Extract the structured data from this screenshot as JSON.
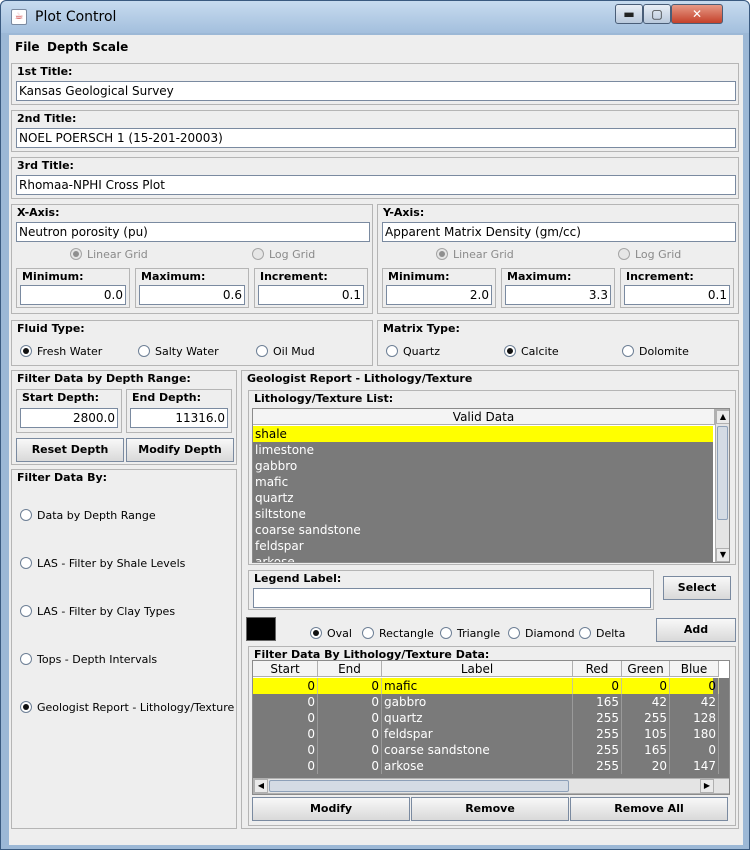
{
  "window": {
    "title": "Plot Control",
    "controls": {
      "minimize": "▬",
      "maximize": "▢",
      "close": "✕"
    }
  },
  "menu": [
    "File",
    "Depth Scale"
  ],
  "titles": [
    {
      "label": "1st Title:",
      "value": "Kansas Geological Survey"
    },
    {
      "label": "2nd Title:",
      "value": "NOEL POERSCH 1 (15-201-20003)"
    },
    {
      "label": "3rd Title:",
      "value": "Rhomaa-NPHI Cross Plot"
    }
  ],
  "xaxis": {
    "label": "X-Axis:",
    "name": "Neutron porosity (pu)",
    "linear": "Linear Grid",
    "log": "Log Grid",
    "min_label": "Minimum:",
    "min": "0.0",
    "max_label": "Maximum:",
    "max": "0.6",
    "inc_label": "Increment:",
    "inc": "0.1"
  },
  "yaxis": {
    "label": "Y-Axis:",
    "name": "Apparent Matrix Density (gm/cc)",
    "linear": "Linear Grid",
    "log": "Log Grid",
    "min_label": "Minimum:",
    "min": "2.0",
    "max_label": "Maximum:",
    "max": "3.3",
    "inc_label": "Increment:",
    "inc": "0.1"
  },
  "fluid": {
    "label": "Fluid Type:",
    "options": [
      "Fresh Water",
      "Salty Water",
      "Oil Mud"
    ],
    "selected": "Fresh Water"
  },
  "matrix": {
    "label": "Matrix Type:",
    "options": [
      "Quartz",
      "Calcite",
      "Dolomite"
    ],
    "selected": "Calcite"
  },
  "depth_range": {
    "label": "Filter Data by Depth Range:",
    "start_label": "Start Depth:",
    "start": "2800.0",
    "end_label": "End Depth:",
    "end": "11316.0",
    "reset": "Reset Depth",
    "modify": "Modify Depth"
  },
  "filter_by": {
    "label": "Filter Data By:",
    "options": [
      "Data by Depth Range",
      "LAS - Filter by Shale Levels",
      "LAS - Filter by Clay Types",
      "Tops - Depth Intervals",
      "Geologist Report - Lithology/Texture"
    ],
    "selected": "Geologist Report - Lithology/Texture"
  },
  "geo": {
    "label": "Geologist Report - Lithology/Texture",
    "list_label": "Lithology/Texture List:",
    "list_header": "Valid Data",
    "list_items": [
      "shale",
      "limestone",
      "gabbro",
      "mafic",
      "quartz",
      "siltstone",
      "coarse sandstone",
      "feldspar",
      "arkose"
    ],
    "list_selected": "shale",
    "legend_label": "Legend Label:",
    "legend_value": "",
    "select": "Select",
    "add": "Add",
    "symbol_color": "#000000",
    "symbols": [
      "Oval",
      "Rectangle",
      "Triangle",
      "Diamond",
      "Delta"
    ],
    "symbol_selected": "Oval",
    "table_label": "Filter Data By Lithology/Texture Data:",
    "columns": [
      "Start",
      "End",
      "Label",
      "Red",
      "Green",
      "Blue"
    ],
    "rows": [
      [
        "0",
        "0",
        "mafic",
        "0",
        "0",
        "0"
      ],
      [
        "0",
        "0",
        "gabbro",
        "165",
        "42",
        "42"
      ],
      [
        "0",
        "0",
        "quartz",
        "255",
        "255",
        "128"
      ],
      [
        "0",
        "0",
        "feldspar",
        "255",
        "105",
        "180"
      ],
      [
        "0",
        "0",
        "coarse sandstone",
        "255",
        "165",
        "0"
      ],
      [
        "0",
        "0",
        "arkose",
        "255",
        "20",
        "147"
      ]
    ],
    "modify": "Modify",
    "remove": "Remove",
    "remove_all": "Remove All"
  },
  "colors": {
    "selection": "#ffff00",
    "unselected_row": "#7a7a7a",
    "window_frame": "#9cb8d6",
    "close_button": "#c4412a"
  }
}
